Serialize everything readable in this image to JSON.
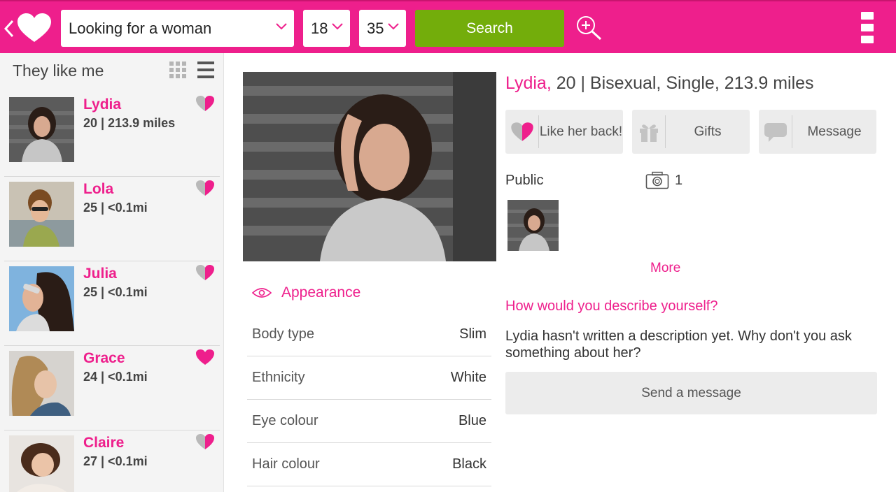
{
  "app": {
    "colors": {
      "brand": "#ee1f8c",
      "search": "#73ad0b",
      "heart_inactive": "#b9b9b9"
    }
  },
  "topbar": {
    "looking_for": "Looking for a woman",
    "age_min": "18",
    "age_max": "35",
    "search_label": "Search",
    "icons": [
      "back-icon",
      "logo-heart-icon",
      "chevron-down-icon",
      "zoom-in-icon",
      "overflow-menu-icon"
    ]
  },
  "sidebar": {
    "title": "They like me",
    "items": [
      {
        "name": "Lydia",
        "meta": "20 | 213.9 miles",
        "liked_back": false
      },
      {
        "name": "Lola",
        "meta": "25 | <0.1mi",
        "liked_back": false
      },
      {
        "name": "Julia",
        "meta": "25 | <0.1mi",
        "liked_back": false
      },
      {
        "name": "Grace",
        "meta": "24 | <0.1mi",
        "liked_back": true
      },
      {
        "name": "Claire",
        "meta": "27 | <0.1mi",
        "liked_back": false
      }
    ]
  },
  "profile": {
    "name": "Lydia,",
    "details": " 20 | Bisexual, Single, 213.9 miles",
    "actions": {
      "like_back": "Like her back!",
      "gifts": "Gifts",
      "message": "Message"
    },
    "public_label": "Public",
    "photo_count": "1",
    "more_label": "More",
    "appearance": {
      "title": "Appearance",
      "rows": [
        {
          "label": "Body type",
          "value": "Slim"
        },
        {
          "label": "Ethnicity",
          "value": "White"
        },
        {
          "label": "Eye colour",
          "value": "Blue"
        },
        {
          "label": "Hair colour",
          "value": "Black"
        }
      ]
    },
    "question": "How would you describe yourself?",
    "description": "Lydia hasn't written a description yet. Why don't you ask something about her?",
    "send_message": "Send a message"
  }
}
